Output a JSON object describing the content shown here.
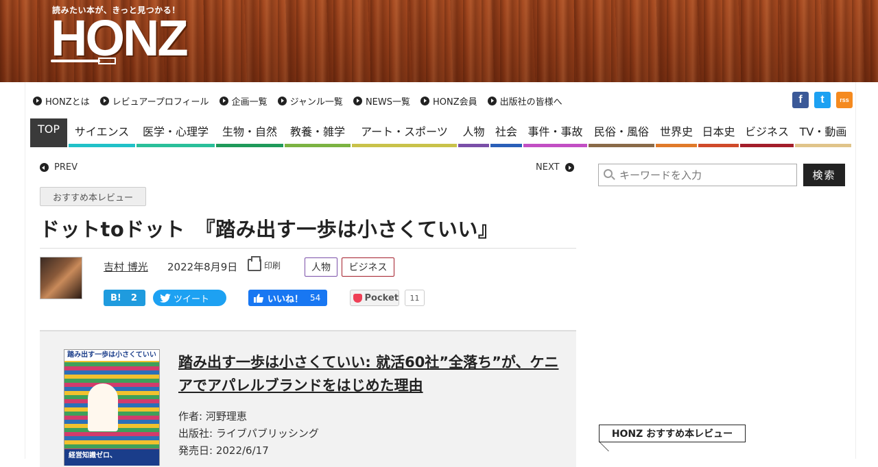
{
  "header": {
    "tagline": "読みたい本が、きっと見つかる！",
    "logo": "HONZ"
  },
  "top_links": [
    {
      "label": "HONZとは"
    },
    {
      "label": "レビュアープロフィール"
    },
    {
      "label": "企画一覧"
    },
    {
      "label": "ジャンル一覧"
    },
    {
      "label": "NEWS一覧"
    },
    {
      "label": "HONZ会員"
    },
    {
      "label": "出版社の皆様へ"
    }
  ],
  "social": {
    "facebook": "f",
    "twitter": "t",
    "rss": "rss"
  },
  "nav": [
    {
      "label": "TOP",
      "width": 54,
      "color": "#3a3a3a"
    },
    {
      "label": "サイエンス",
      "width": 97,
      "color": "#21c1c8"
    },
    {
      "label": "医学・心理学",
      "width": 114,
      "color": "#2abf9a"
    },
    {
      "label": "生物・自然",
      "width": 98,
      "color": "#1f9a5a"
    },
    {
      "label": "教養・雑学",
      "width": 96,
      "color": "#7cb342"
    },
    {
      "label": "アート・スポーツ",
      "width": 153,
      "color": "#c9c24a"
    },
    {
      "label": "人物",
      "width": 45,
      "color": "#7a4fa8"
    },
    {
      "label": "社会",
      "width": 46,
      "color": "#2a5fb8"
    },
    {
      "label": "事件・事故",
      "width": 93,
      "color": "#c24fc4"
    },
    {
      "label": "民俗・風俗",
      "width": 96,
      "color": "#8a6a48"
    },
    {
      "label": "世界史",
      "width": 60,
      "color": "#e07a2a"
    },
    {
      "label": "日本史",
      "width": 59,
      "color": "#d04a2a"
    },
    {
      "label": "ビジネス",
      "width": 78,
      "color": "#a31d2a"
    },
    {
      "label": "TV・動画",
      "width": 82,
      "color": "#e0c48a"
    }
  ],
  "pager": {
    "prev": "PREV",
    "next": "NEXT"
  },
  "article": {
    "category": "おすすめ本レビュー",
    "title": "ドットtoドット　『踏み出す一歩は小さくていい』",
    "author": "吉村 博光",
    "date": "2022年8月9日",
    "print_label": "印刷",
    "tags": [
      "人物",
      "ビジネス"
    ]
  },
  "share": {
    "hatena_label": "B!",
    "hatena_count": "2",
    "tweet_label": "ツイート",
    "like_label": "いいね！",
    "like_count": "54",
    "pocket_label": "Pocket",
    "pocket_count": "11"
  },
  "book": {
    "title": "踏み出す一歩は小さくていい: 就活60社”全落ち”が、ケニアでアパレルブランドをはじめた理由",
    "cover_title": "踏み出す一歩は小さくていい",
    "cover_band": "経営知識ゼロ、",
    "author_line": "作者: 河野理恵",
    "publisher_line": "出版社: ライブパブリッシング",
    "release_line": "発売日: 2022/6/17"
  },
  "sidebar": {
    "search_placeholder": "キーワードを入力",
    "search_button": "検索",
    "recommend_label": "HONZ おすすめ本レビュー"
  }
}
